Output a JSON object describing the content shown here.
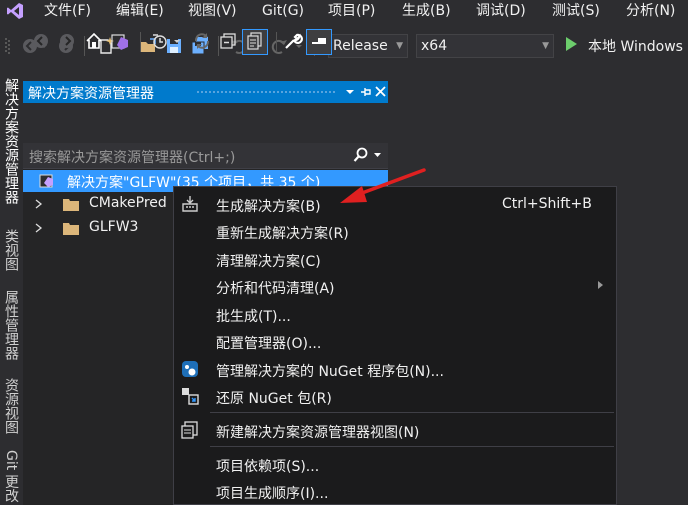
{
  "menubar": {
    "items": [
      "文件(F)",
      "编辑(E)",
      "视图(V)",
      "Git(G)",
      "项目(P)",
      "生成(B)",
      "调试(D)",
      "测试(S)",
      "分析(N)"
    ]
  },
  "toolbar": {
    "configuration": "Release",
    "platform": "x64",
    "run_label": "本地 Windows"
  },
  "side_tabs": [
    "解决方案资源管理器",
    "类视图",
    "属性管理器",
    "资源视图",
    "Git 更改"
  ],
  "solution_explorer": {
    "title": "解决方案资源管理器",
    "pin_glyph": "▾ ⊣ ✕",
    "search_placeholder": "搜索解决方案资源管理器(Ctrl+;)",
    "solution_node": "解决方案\"GLFW\"(35 个项目，共 35 个)",
    "projects": [
      "CMakePred",
      "GLFW3"
    ]
  },
  "context_menu": {
    "items": [
      {
        "label": "生成解决方案(B)",
        "shortcut": "Ctrl+Shift+B",
        "icon": "build-solution-icon"
      },
      {
        "label": "重新生成解决方案(R)"
      },
      {
        "label": "清理解决方案(C)"
      },
      {
        "label": "分析和代码清理(A)",
        "submenu": true
      },
      {
        "label": "批生成(T)..."
      },
      {
        "label": "配置管理器(O)..."
      },
      {
        "label": "管理解决方案的 NuGet 程序包(N)...",
        "icon": "nuget-icon"
      },
      {
        "label": "还原 NuGet 包(R)",
        "icon": "restore-package-icon"
      },
      {
        "label": "新建解决方案资源管理器视图(N)",
        "icon": "new-view-icon"
      },
      {
        "label": "项目依赖项(S)..."
      },
      {
        "label": "项目生成顺序(I)..."
      }
    ]
  },
  "colors": {
    "accent": "#007acc",
    "selection": "#3399ff",
    "annotation_arrow": "#e02020"
  }
}
